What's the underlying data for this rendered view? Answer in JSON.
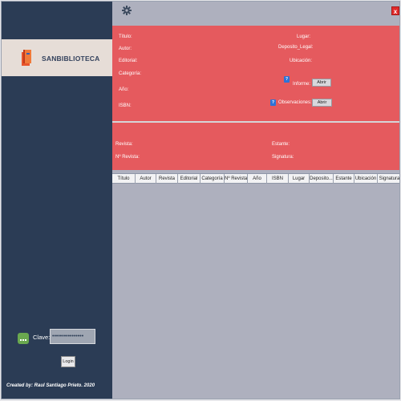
{
  "app": {
    "title": "SANBIBLIOTECA",
    "credits": "Created by: Raul Santiago Prieto. 2020"
  },
  "login": {
    "clave_label": "Clave:",
    "clave_value": "••••••••••••••••",
    "login_label": "Login"
  },
  "window": {
    "close_label": "x"
  },
  "form": {
    "titulo": "Título:",
    "autor": "Autor:",
    "editorial": "Editorial:",
    "categoria": "Categoría:",
    "anio": "Año:",
    "isbn": "ISBN:",
    "lugar": "Lugar:",
    "deposito_legal": "Deposito_Legal:",
    "ubicacion": "Ubicación:",
    "informe": "Informe:",
    "observaciones": "Observaciones:",
    "abrir": "Abrir",
    "help": "?",
    "revista": "Revista:",
    "n_revista": "Nº Revista:",
    "estante": "Estante:",
    "signatura": "Signatura:"
  },
  "table": {
    "columns": [
      "Título",
      "Autor",
      "Revista",
      "Editorial",
      "Categoría",
      "Nº Revista",
      "Año",
      "ISBN",
      "Lugar",
      "Deposito...",
      "Estante",
      "Ubicación",
      "Signatura"
    ]
  },
  "colors": {
    "sidebar": "#2b3c55",
    "panel": "#e55a5e",
    "brand_band": "#e6ddd7",
    "background": "#aeb0be"
  }
}
